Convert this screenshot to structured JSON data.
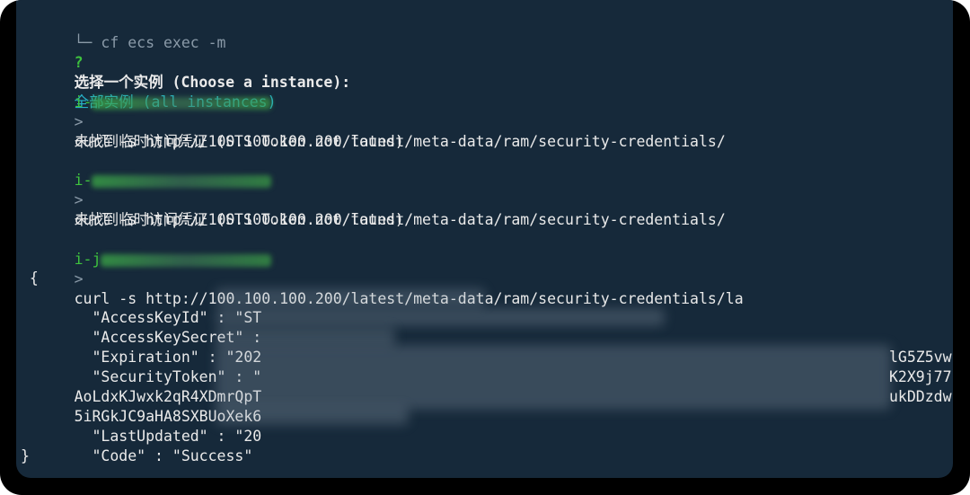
{
  "terminal": {
    "top_command": "└─ cf ecs exec -m",
    "prompt": {
      "question_mark": "?",
      "label": "选择一个实例 (Choose a instance):",
      "answer": "全部实例 (all instances)"
    },
    "instance_prefix_1": "i-",
    "instance_prefix_2": "i-",
    "instance_prefix_3": "i-j",
    "arrow": ">",
    "curl_cmd": "curl -s http://100.100.100.200/latest/meta-data/ram/security-credentials/",
    "curl_cmd_3": "curl -s http://100.100.100.200/latest/meta-data/ram/security-credentials/la",
    "not_found": "未找到临时访问凭证 (STS Token not found)",
    "json_open": " {",
    "json_lines": [
      "  \"AccessKeyId\" : \"ST",
      "  \"AccessKeySecret\" :",
      "  \"Expiration\" : \"202",
      "  \"SecurityToken\" : \"",
      "AoLdxKJwxk2qR4XDmrQpT",
      "5iRGkJC9aHA8SXBUoXek6",
      "  \"LastUpdated\" : \"20",
      "  \"Code\" : \"Success\""
    ],
    "token_tail_1": "lG5Z5vw",
    "token_tail_2": "K2X9j77",
    "token_tail_3": "ukDDzdw",
    "json_close": "}"
  }
}
